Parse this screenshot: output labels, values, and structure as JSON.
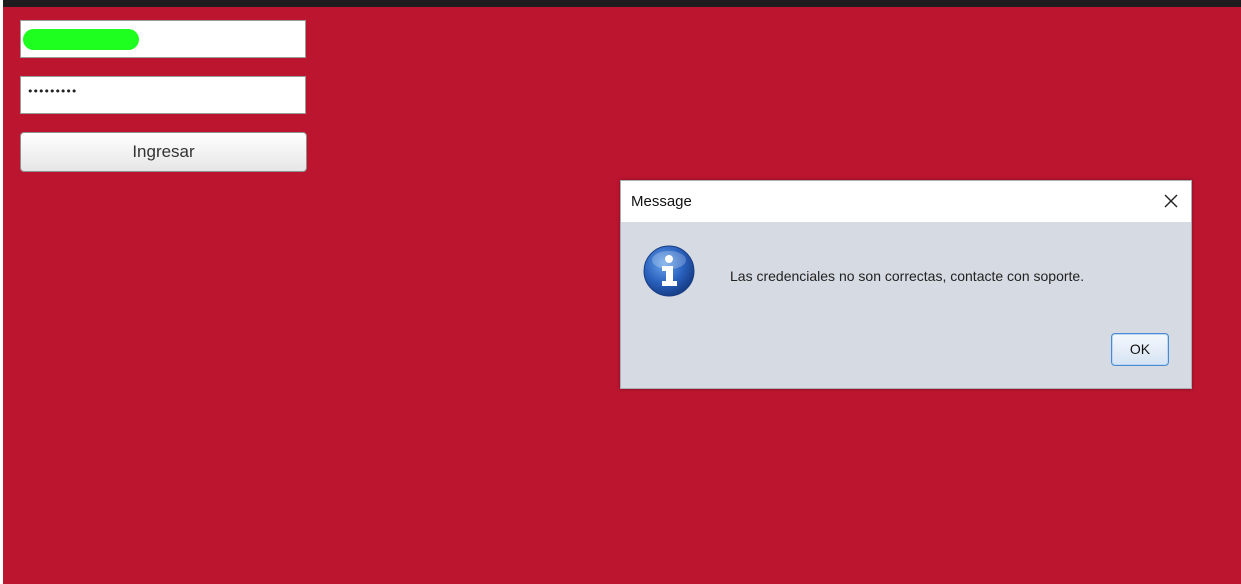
{
  "login": {
    "password_mask": "•••••••••",
    "submit_label": "Ingresar"
  },
  "dialog": {
    "title": "Message",
    "message": "Las credenciales no son correctas, contacte con soporte.",
    "ok_label": "OK",
    "icon": "info-icon",
    "close_icon": "close-icon"
  },
  "colors": {
    "background": "#bb1530",
    "redaction": "#1fff1f",
    "dialog_body": "#d6dae2"
  }
}
